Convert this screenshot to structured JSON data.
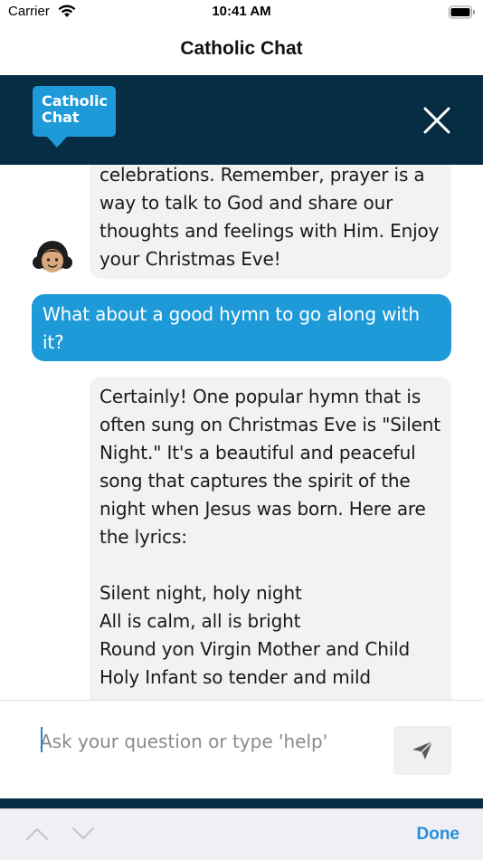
{
  "status_bar": {
    "carrier": "Carrier",
    "time": "10:41 AM"
  },
  "nav": {
    "title": "Catholic Chat"
  },
  "banner": {
    "logo_line1": "Catholic",
    "logo_line2": "Chat",
    "brand_color": "#072d45",
    "accent_color": "#1e9ad8"
  },
  "messages": [
    {
      "sender": "bot",
      "text": "celebrations. Remember, prayer is a\nway to talk to God and share our\nthoughts and feelings with Him. Enjoy\nyour Christmas Eve!"
    },
    {
      "sender": "user",
      "text": "What about a good hymn to go along with\nit?"
    },
    {
      "sender": "bot",
      "text": "Certainly! One popular hymn that is\noften sung on Christmas Eve is \"Silent\nNight.\" It's a beautiful and peaceful\nsong that captures the spirit of the\nnight when Jesus was born. Here are\nthe lyrics:\n\nSilent night, holy night\nAll is calm, all is bright\nRound yon Virgin Mother and Child\nHoly Infant so tender and mild"
    }
  ],
  "input": {
    "placeholder": "Ask your question or type 'help'",
    "value": ""
  },
  "keyboard_bar": {
    "done_label": "Done"
  },
  "icons": {
    "close": "close-icon",
    "send": "send-icon",
    "avatar": "avatar-icon",
    "wifi": "wifi-icon",
    "battery": "battery-icon"
  }
}
